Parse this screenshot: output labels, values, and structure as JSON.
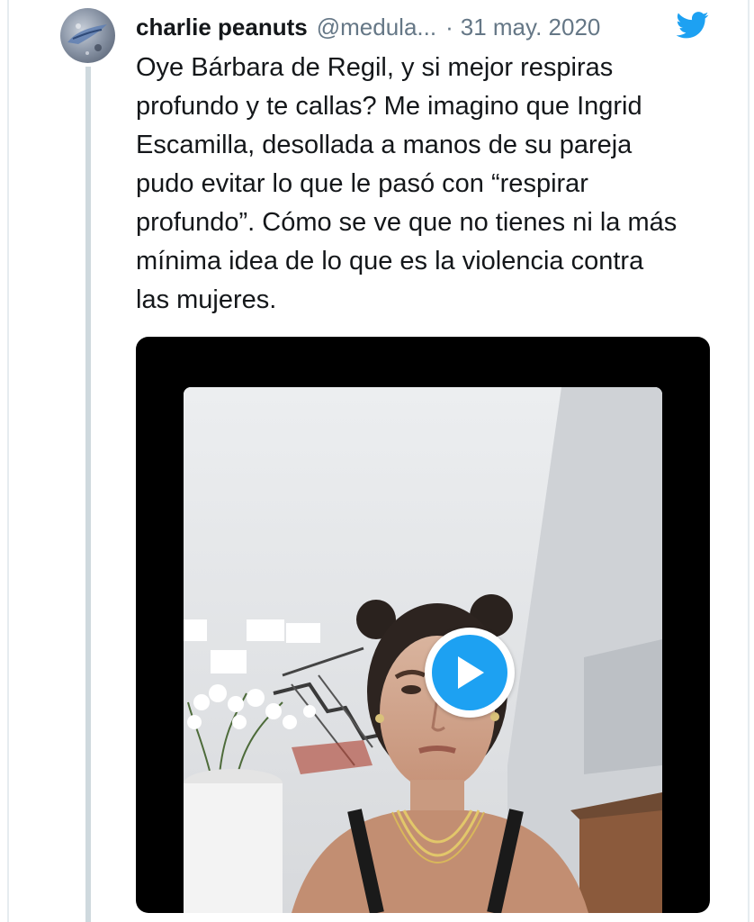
{
  "tweet": {
    "author_name": "charlie peanuts",
    "author_handle": "@medula...",
    "separator": "·",
    "date": "31 may. 2020",
    "text_lines": [
      "Oye Bárbara de Regil, y si mejor respiras",
      "profundo y te callas? Me imagino que Ingrid",
      "Escamilla, desollada a manos de su pareja",
      "pudo evitar lo que le pasó con “respirar",
      "profundo”. Cómo se ve que no tienes ni la más",
      "mínima idea de lo que es la violencia contra",
      "las mujeres."
    ]
  },
  "icons": {
    "avatar": "avatar-image",
    "brand": "twitter-bird-icon",
    "play": "play-icon"
  },
  "colors": {
    "brand_blue": "#1da1f2",
    "text": "#14171a",
    "secondary_text": "#657786",
    "media_background": "#000000",
    "thread_line": "#cfd9de"
  }
}
